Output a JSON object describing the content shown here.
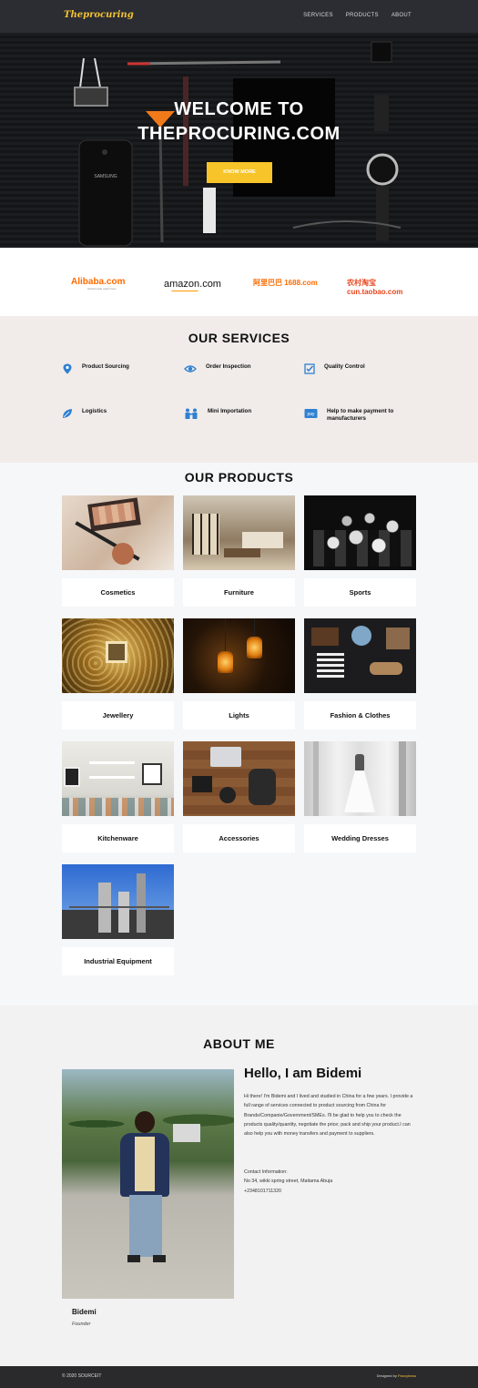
{
  "nav": {
    "brand": "Theprocuring",
    "links": [
      "SERVICES",
      "PRODUCTS",
      "ABOUT"
    ]
  },
  "hero": {
    "title_line1": "WELCOME TO",
    "title_line2": "THEPROCURING.COM",
    "button": "KNOW MORE",
    "phone_brand": "SAMSUNG"
  },
  "partners": {
    "logos": [
      "Alibaba.com",
      "amazon.com",
      "阿里巴巴 1688.com",
      "农村淘宝 cun.taobao.com"
    ],
    "alibaba_tagline": "Global trade starts here."
  },
  "services": {
    "title": "OUR SERVICES",
    "items": [
      {
        "label": "Product Sourcing",
        "icon": "map-pin-icon"
      },
      {
        "label": "Order Inspection",
        "icon": "eye-icon"
      },
      {
        "label": "Quality Control",
        "icon": "checkbox-icon"
      },
      {
        "label": "Logistics",
        "icon": "leaf-icon"
      },
      {
        "label": "Mini Importation",
        "icon": "people-icon"
      },
      {
        "label": "Help to make payment to manufacturers",
        "icon": "pay-icon"
      }
    ],
    "pay_text": "pay"
  },
  "products": {
    "title": "OUR PRODUCTS",
    "items": [
      {
        "label": "Cosmetics"
      },
      {
        "label": "Furniture"
      },
      {
        "label": "Sports"
      },
      {
        "label": "Jewellery"
      },
      {
        "label": "Lights"
      },
      {
        "label": "Fashion & Clothes"
      },
      {
        "label": "Kitchenware"
      },
      {
        "label": "Accessories"
      },
      {
        "label": "Wedding Dresses"
      },
      {
        "label": "Industrial Equipment"
      }
    ]
  },
  "about": {
    "title": "ABOUT ME",
    "hello": "Hello, I am Bidemi",
    "bio": "Hi there! I'm Bidemi and I lived and studied in China for a few years. I provide a full range of services connected to product sourcing from China for Brands/Companie/Government/SMEs. I'll be glad to help you to check the products quality/quantity, negotiate the price; pack and ship your product.I can also help you with money transfers and payment to suppliers.",
    "contact_heading": "Contact Information:",
    "address": "No 34, wikki spring street, Maitama Abuja",
    "phone": "+2348101711320",
    "name": "Bidemi",
    "role": "Founder"
  },
  "footer": {
    "copyright": "© 2020 SOURCEIT",
    "credit_prefix": "Designed by ",
    "credit_name": "Pancybeau"
  },
  "colors": {
    "accent": "#f7c52a",
    "nav_bg": "#2b2d33",
    "service_icon": "#2f80d1",
    "services_bg": "#f1ecea"
  }
}
